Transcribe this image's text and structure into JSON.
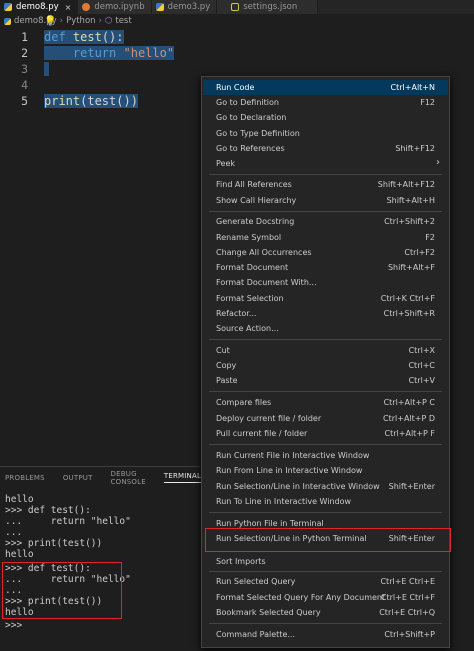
{
  "tabs": [
    {
      "label": "demo8.py",
      "icon": "python-icon",
      "active": true
    },
    {
      "label": "demo.ipynb",
      "icon": "notebook-icon"
    },
    {
      "label": "demo3.py",
      "icon": "python-icon"
    },
    {
      "label": "settings.json",
      "icon": "json-icon"
    }
  ],
  "tab_close": "×",
  "breadcrumb": {
    "file": "demo8.py",
    "lang": "Python",
    "symbol": "test"
  },
  "editor": {
    "line_numbers": [
      "1",
      "2",
      "3",
      "4",
      "5"
    ],
    "code": {
      "kw_def": "def",
      "fn_test": "test",
      "paren_colon": "():",
      "kw_return": "return",
      "str_hello": "\"hello\"",
      "fn_print": "print",
      "call_expr": "(test())"
    }
  },
  "panel": {
    "tabs": [
      "PROBLEMS",
      "OUTPUT",
      "DEBUG CONSOLE",
      "TERMINAL"
    ],
    "active_tab": "TERMINAL"
  },
  "terminal": {
    "lines": [
      "hello",
      ">>> def test():",
      "...     return \"hello\"",
      "...",
      ">>> print(test())",
      "hello",
      ">>> def test():",
      "...     return \"hello\"",
      "...",
      ">>> print(test())",
      "hello",
      ">>>"
    ]
  },
  "context_menu": {
    "items": [
      {
        "label": "Run Code",
        "shortcut": "Ctrl+Alt+N",
        "highlighted": true
      },
      {
        "label": "Go to Definition",
        "shortcut": "F12"
      },
      {
        "label": "Go to Declaration",
        "shortcut": ""
      },
      {
        "label": "Go to Type Definition",
        "shortcut": ""
      },
      {
        "label": "Go to References",
        "shortcut": "Shift+F12"
      },
      {
        "label": "Peek",
        "shortcut": "",
        "submenu": true
      },
      {
        "label": "Find All References",
        "shortcut": "Shift+Alt+F12"
      },
      {
        "label": "Show Call Hierarchy",
        "shortcut": "Shift+Alt+H"
      },
      {
        "label": "Generate Docstring",
        "shortcut": "Ctrl+Shift+2"
      },
      {
        "label": "Rename Symbol",
        "shortcut": "F2"
      },
      {
        "label": "Change All Occurrences",
        "shortcut": "Ctrl+F2"
      },
      {
        "label": "Format Document",
        "shortcut": "Shift+Alt+F"
      },
      {
        "label": "Format Document With...",
        "shortcut": ""
      },
      {
        "label": "Format Selection",
        "shortcut": "Ctrl+K Ctrl+F"
      },
      {
        "label": "Refactor...",
        "shortcut": "Ctrl+Shift+R"
      },
      {
        "label": "Source Action...",
        "shortcut": ""
      },
      {
        "label": "Cut",
        "shortcut": "Ctrl+X"
      },
      {
        "label": "Copy",
        "shortcut": "Ctrl+C"
      },
      {
        "label": "Paste",
        "shortcut": "Ctrl+V"
      },
      {
        "label": "Compare files",
        "shortcut": "Ctrl+Alt+P C"
      },
      {
        "label": "Deploy current file / folder",
        "shortcut": "Ctrl+Alt+P D"
      },
      {
        "label": "Pull current file / folder",
        "shortcut": "Ctrl+Alt+P F"
      },
      {
        "label": "Run Current File in Interactive Window",
        "shortcut": ""
      },
      {
        "label": "Run From Line in Interactive Window",
        "shortcut": ""
      },
      {
        "label": "Run Selection/Line in Interactive Window",
        "shortcut": "Shift+Enter"
      },
      {
        "label": "Run To Line in Interactive Window",
        "shortcut": ""
      },
      {
        "label": "Run Python File in Terminal",
        "shortcut": ""
      },
      {
        "label": "Run Selection/Line in Python Terminal",
        "shortcut": "Shift+Enter",
        "boxed": true
      },
      {
        "label": "Sort Imports",
        "shortcut": ""
      },
      {
        "label": "Run Selected Query",
        "shortcut": "Ctrl+E Ctrl+E"
      },
      {
        "label": "Format Selected Query For Any Document",
        "shortcut": "Ctrl+E Ctrl+F"
      },
      {
        "label": "Bookmark Selected Query",
        "shortcut": "Ctrl+E Ctrl+Q"
      },
      {
        "label": "Command Palette...",
        "shortcut": "Ctrl+Shift+P"
      }
    ]
  },
  "colors": {
    "editor_bg": "#1e1e1e",
    "menu_bg": "#252526",
    "menu_highlight": "#04395e",
    "selection": "#264f78",
    "annotation_red": "#e0242b"
  }
}
